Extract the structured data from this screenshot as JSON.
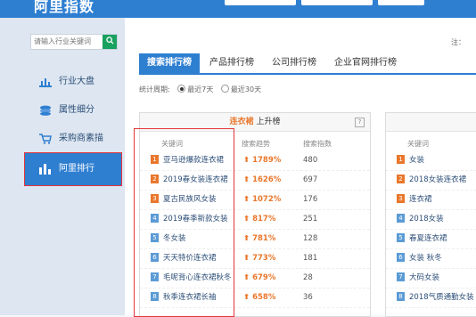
{
  "header": {
    "logo_text": "阿里指数"
  },
  "search": {
    "placeholder": "请输入行业关键词",
    "button_icon": "search-icon"
  },
  "sidebar": {
    "items": [
      {
        "label": "行业大盘",
        "icon": "chart-icon"
      },
      {
        "label": "属性细分",
        "icon": "layers-icon"
      },
      {
        "label": "采购商素描",
        "icon": "cart-icon"
      },
      {
        "label": "阿里排行",
        "icon": "bar-chart-icon",
        "active": true
      }
    ]
  },
  "note": "注：",
  "tabs": [
    "搜索排行榜",
    "产品排行榜",
    "公司排行榜",
    "企业官网排行榜"
  ],
  "period": {
    "label": "统计周期:",
    "options": [
      "最近7天",
      "最近30天"
    ],
    "selected": "最近7天"
  },
  "left_panel": {
    "title_tag": "连衣裙",
    "title_suffix": "上升榜",
    "help": "?",
    "columns": [
      "关键词",
      "搜索趋势",
      "搜索指数"
    ],
    "rows": [
      {
        "rank": "1",
        "keyword": "亚马逊爆款连衣裙",
        "trend": "1789%",
        "index": "480"
      },
      {
        "rank": "2",
        "keyword": "2019春女装连衣裙",
        "trend": "1626%",
        "index": "697"
      },
      {
        "rank": "3",
        "keyword": "夏古民族风女装",
        "trend": "1072%",
        "index": "176"
      },
      {
        "rank": "4",
        "keyword": "2019春季新款女装",
        "trend": "817%",
        "index": "251"
      },
      {
        "rank": "5",
        "keyword": "冬女装",
        "trend": "781%",
        "index": "128"
      },
      {
        "rank": "6",
        "keyword": "天天特价连衣裙",
        "trend": "773%",
        "index": "181"
      },
      {
        "rank": "7",
        "keyword": "毛呢背心连衣裙秋冬",
        "trend": "679%",
        "index": "28"
      },
      {
        "rank": "8",
        "keyword": "秋季连衣裙长袖",
        "trend": "658%",
        "index": "36"
      }
    ]
  },
  "right_panel": {
    "columns": [
      "关键词"
    ],
    "rows": [
      {
        "rank": "1",
        "keyword": "女装"
      },
      {
        "rank": "2",
        "keyword": "2018女装连衣裙"
      },
      {
        "rank": "3",
        "keyword": "连衣裙"
      },
      {
        "rank": "4",
        "keyword": "2018女装"
      },
      {
        "rank": "5",
        "keyword": "春夏连衣裙"
      },
      {
        "rank": "6",
        "keyword": "女装 秋冬"
      },
      {
        "rank": "7",
        "keyword": "大码女装"
      },
      {
        "rank": "8",
        "keyword": "2018气质通勤女装"
      }
    ]
  },
  "colors": {
    "brand_blue": "#2f7fd1",
    "accent_orange": "#e9772b",
    "highlight_red": "#e2363a",
    "search_green": "#19a15f"
  }
}
